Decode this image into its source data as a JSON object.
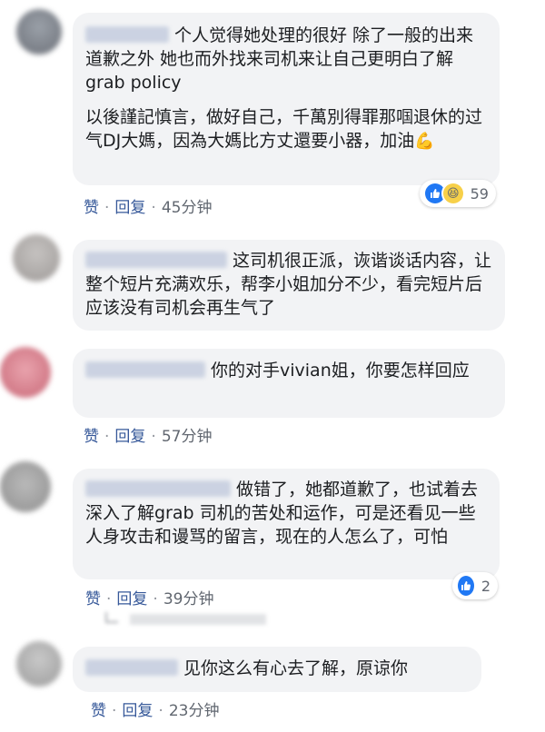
{
  "comments": [
    {
      "paragraphs": [
        "个人觉得她处理的很好 除了一般的出来道歉之外 她也而外找来司机来让自己更明白了解grab policy",
        "以後謹記慎言，做好自己，千萬別得罪那啯退休的过气DJ大媽，因為大媽比方丈還要小器，加油"
      ],
      "emoji": "💪",
      "like_label": "赞",
      "reply_label": "回复",
      "time": "45分钟",
      "reaction_count": "59",
      "reaction_icons": [
        "like-icon",
        "haha-icon"
      ]
    },
    {
      "paragraphs": [
        "这司机很正派，诙谐谈话内容，让整个短片充满欢乐，帮李小姐加分不少，看完短片后应该没有司机会再生气了"
      ]
    },
    {
      "paragraphs": [
        "你的对手vivian姐，你要怎样回应"
      ],
      "like_label": "赞",
      "reply_label": "回复",
      "time": "57分钟"
    },
    {
      "paragraphs": [
        "做错了，她都道歉了，也试着去深入了解grab 司机的苦处和运作，可是还看见一些人身攻击和谩骂的留言，现在的人怎么了，可怕"
      ],
      "like_label": "赞",
      "reply_label": "回复",
      "time": "39分钟",
      "reaction_count": "2",
      "reaction_icons": [
        "like-icon"
      ]
    },
    {
      "paragraphs": [
        "见你这么有心去了解，原谅你"
      ],
      "like_label": "赞",
      "reply_label": "回复",
      "time": "23分钟"
    }
  ],
  "colors": {
    "bubble": "#f2f3f5",
    "link": "#365899",
    "meta": "#616770",
    "like": "#2078f4"
  }
}
